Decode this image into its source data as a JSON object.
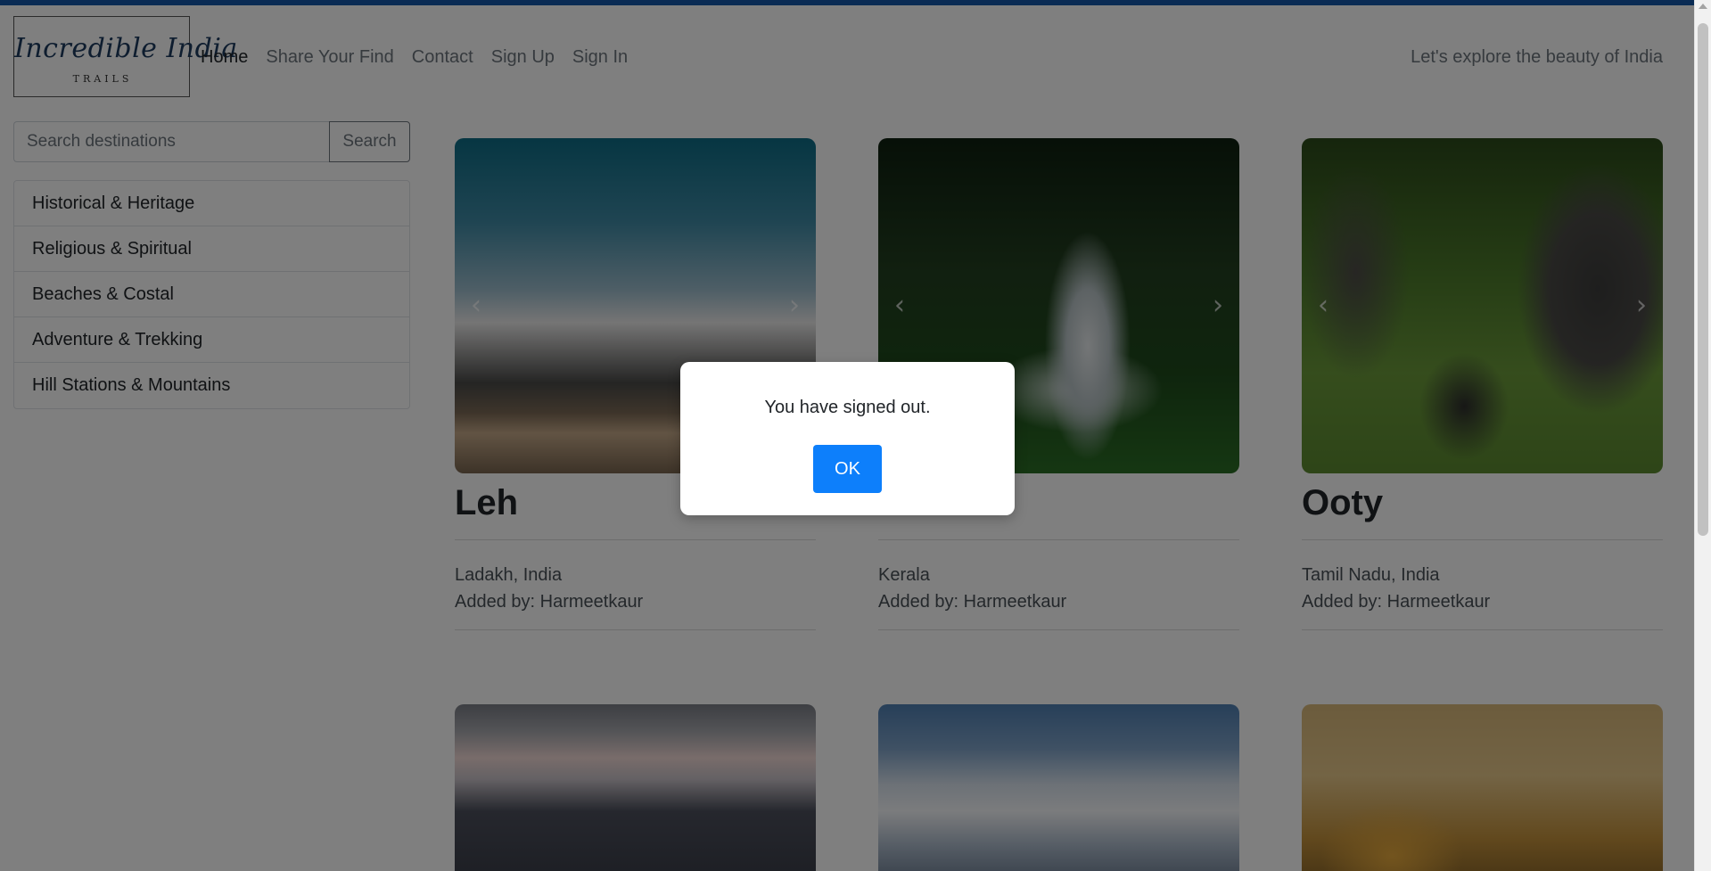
{
  "brand": {
    "logo_script": "Incredible India",
    "logo_sub": "TRAILS"
  },
  "nav": {
    "links": [
      "Home",
      "Share Your Find",
      "Contact",
      "Sign Up",
      "Sign In"
    ],
    "active": "Home",
    "tagline": "Let's explore the beauty of India"
  },
  "search": {
    "placeholder": "Search destinations",
    "button": "Search"
  },
  "categories": [
    "Historical & Heritage",
    "Religious & Spiritual",
    "Beaches & Costal",
    "Adventure & Trekking",
    "Hill Stations & Mountains"
  ],
  "cards": [
    {
      "title": "Leh",
      "location": "Ladakh, India",
      "added_by": "Added by: Harmeetkaur",
      "image_icon": "mountain-clouds-photo"
    },
    {
      "title": "",
      "location": "Kerala",
      "added_by": "Added by: Harmeetkaur",
      "image_icon": "waterfall-forest-photo"
    },
    {
      "title": "Ooty",
      "location": "Tamil Nadu, India",
      "added_by": "Added by: Harmeetkaur",
      "image_icon": "elephants-photo"
    },
    {
      "image_icon": "snow-peaks-photo"
    },
    {
      "image_icon": "snowy-mountains-photo"
    },
    {
      "image_icon": "palace-domes-photo"
    }
  ],
  "carousel": {
    "prev_icon": "chevron-left-icon",
    "next_icon": "chevron-right-icon"
  },
  "modal": {
    "message": "You have signed out.",
    "ok_label": "OK"
  },
  "colors": {
    "accent": "#0d7ffb",
    "top_stripe": "#1457a8",
    "overlay": "rgba(0,0,0,0.5)"
  }
}
